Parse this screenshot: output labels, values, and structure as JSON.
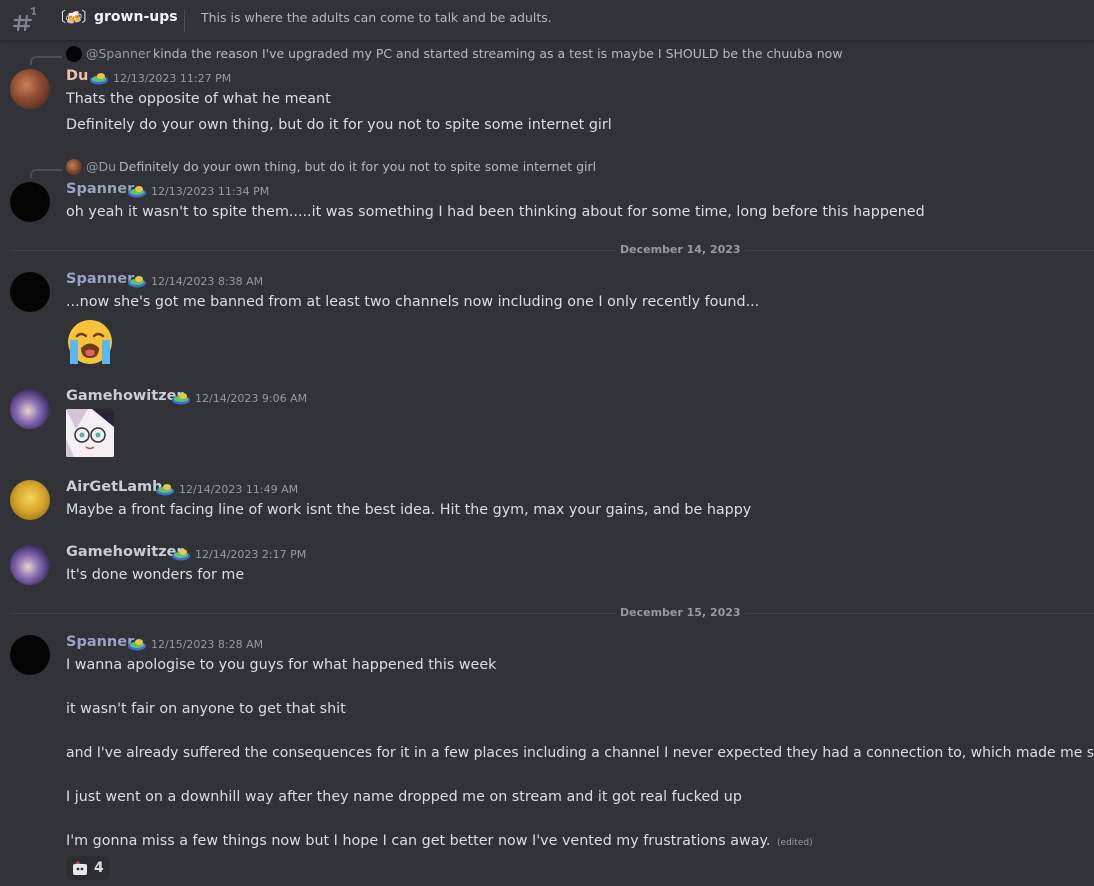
{
  "channel": {
    "emoji": "〔🍻〕",
    "name": "grown-ups",
    "topic": "This is where the adults can come to talk and be adults."
  },
  "messages": [
    {
      "reply": {
        "name": "@Spanner",
        "text": "kinda the reason I've upgraded my PC and started streaming as a test is maybe I SHOULD be the chuuba now"
      },
      "author": "Du",
      "timestamp": "12/13/2023 11:27 PM",
      "lines": [
        "Thats the opposite of what he meant",
        "Definitely do your own thing, but do it for you not to spite some internet girl"
      ]
    },
    {
      "reply": {
        "name": "@Du",
        "text": "Definitely do your own thing, but do it for you not to spite some internet girl"
      },
      "author": "Spanner",
      "timestamp": "12/13/2023 11:34 PM",
      "lines": [
        "oh yeah it wasn't to spite them.....it was something I had been thinking about for some time, long before this happened"
      ]
    },
    {
      "date": "December 14, 2023"
    },
    {
      "author": "Spanner",
      "timestamp": "12/14/2023 8:38 AM",
      "lines": [
        "...now she's got me banned from at least two channels now including one I only recently found..."
      ],
      "emoji": "😭"
    },
    {
      "author": "Gamehowitzer",
      "timestamp": "12/14/2023 9:06 AM"
    },
    {
      "author": "AirGetLamh",
      "timestamp": "12/14/2023 11:49 AM",
      "lines": [
        "Maybe a front facing line of work isnt the best idea. Hit the gym, max your gains, and be happy"
      ]
    },
    {
      "author": "Gamehowitzer",
      "timestamp": "12/14/2023 2:17 PM",
      "lines": [
        "It's done wonders for me"
      ]
    },
    {
      "date": "December 15, 2023"
    },
    {
      "author": "Spanner",
      "timestamp": "12/15/2023 8:28 AM",
      "lines": [
        "I wanna apologise to you guys for what happened this week",
        "it wasn't fair on anyone to get that shit",
        "and I've already suffered the consequences for it in a few places including a channel I never expected they had a connection to, which made me sadder",
        "I just went on a downhill way after they name dropped me on stream and it got real fucked up",
        "I'm gonna miss a few things now but I hope I can get better now I've vented my frustrations away."
      ],
      "edited": "(edited)",
      "reaction": {
        "count": "4"
      }
    }
  ]
}
